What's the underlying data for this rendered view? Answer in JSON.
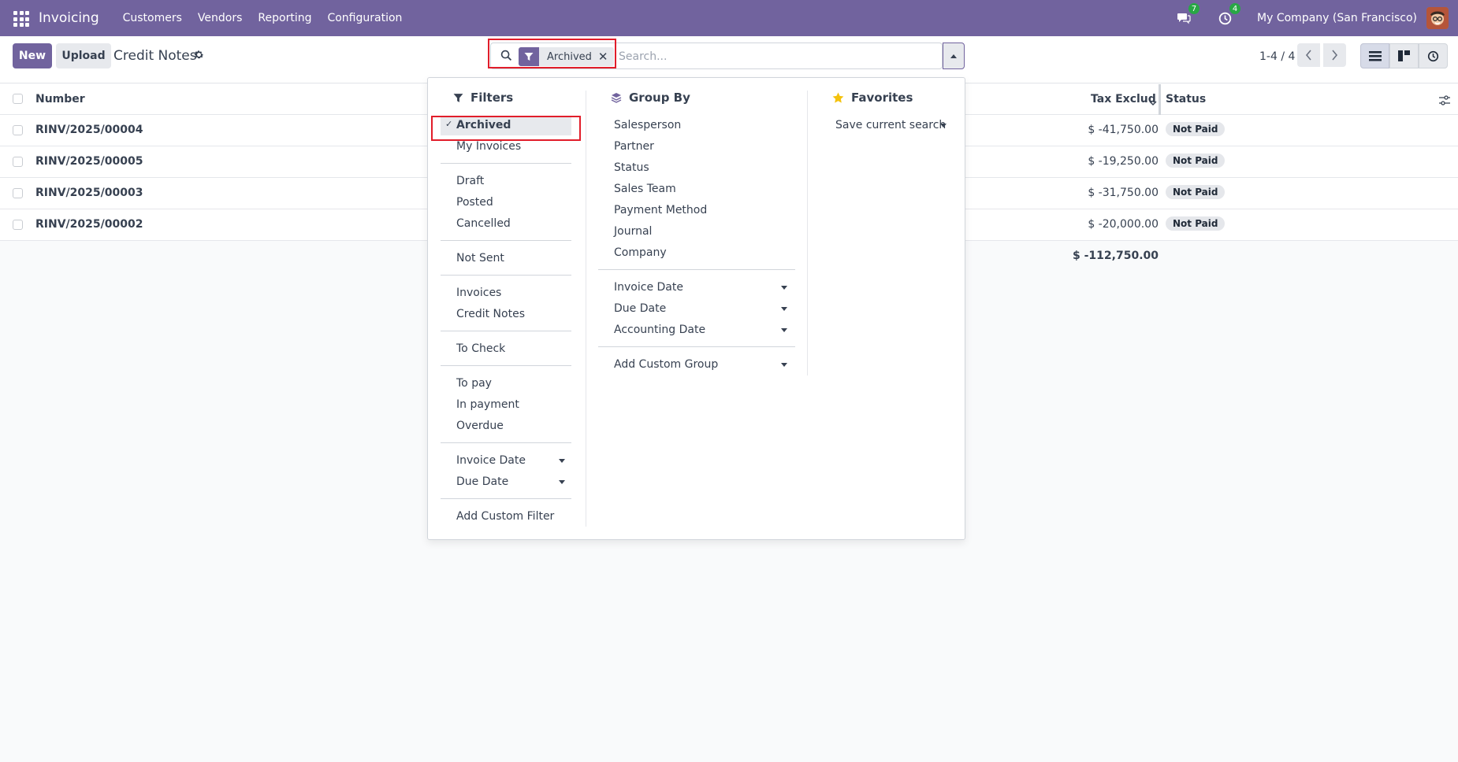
{
  "navbar": {
    "app_name": "Invoicing",
    "menu": [
      "Customers",
      "Vendors",
      "Reporting",
      "Configuration"
    ],
    "messages_count": "7",
    "activities_count": "4",
    "company": "My Company (San Francisco)"
  },
  "control_panel": {
    "new_label": "New",
    "upload_label": "Upload",
    "title": "Credit Notes",
    "facet_label": "Archived",
    "search_placeholder": "Search...",
    "pager": "1-4 / 4"
  },
  "list": {
    "columns": {
      "number": "Number",
      "tax_excluded": "Tax Exclud",
      "status": "Status"
    },
    "rows": [
      {
        "number": "RINV/2025/00004",
        "amount": "$ -41,750.00",
        "status": "Not Paid"
      },
      {
        "number": "RINV/2025/00005",
        "amount": "$ -19,250.00",
        "status": "Not Paid"
      },
      {
        "number": "RINV/2025/00003",
        "amount": "$ -31,750.00",
        "status": "Not Paid"
      },
      {
        "number": "RINV/2025/00002",
        "amount": "$ -20,000.00",
        "status": "Not Paid"
      }
    ],
    "total": "$ -112,750.00"
  },
  "dropdown": {
    "filters": {
      "title": "Filters",
      "items": [
        "Archived",
        "My Invoices",
        "Draft",
        "Posted",
        "Cancelled",
        "Not Sent",
        "Invoices",
        "Credit Notes",
        "To Check",
        "To pay",
        "In payment",
        "Overdue",
        "Invoice Date",
        "Due Date",
        "Add Custom Filter"
      ]
    },
    "group_by": {
      "title": "Group By",
      "items": [
        "Salesperson",
        "Partner",
        "Status",
        "Sales Team",
        "Payment Method",
        "Journal",
        "Company",
        "Invoice Date",
        "Due Date",
        "Accounting Date",
        "Add Custom Group"
      ]
    },
    "favorites": {
      "title": "Favorites",
      "items": [
        "Save current search"
      ]
    }
  },
  "colors": {
    "brand": "#71639e",
    "highlight": "#e11d2a",
    "badge": "#28a745"
  }
}
